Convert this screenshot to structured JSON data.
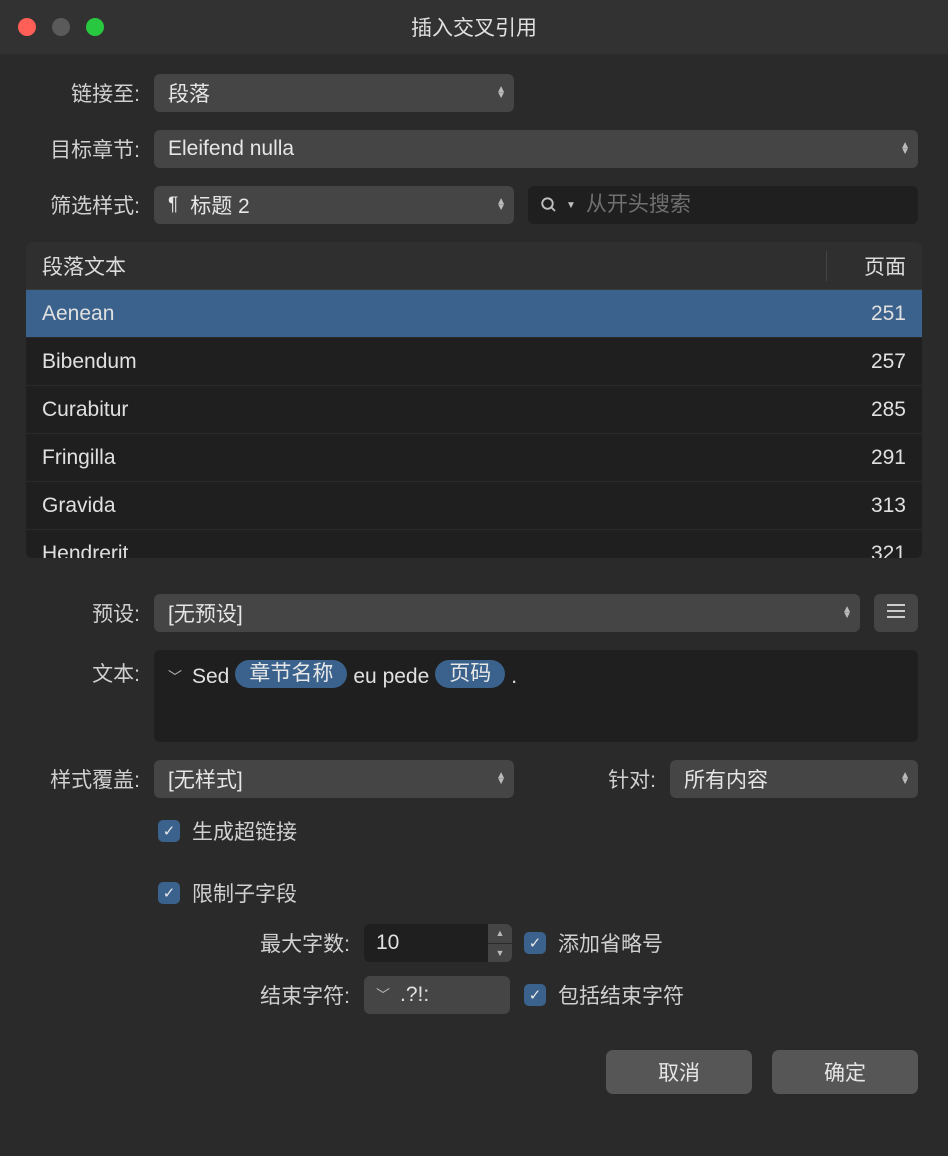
{
  "title": "插入交叉引用",
  "labels": {
    "link_to": "链接至:",
    "target_chapter": "目标章节:",
    "filter_style": "筛选样式:",
    "preset": "预设:",
    "text": "文本:",
    "style_override": "样式覆盖:",
    "for": "针对:",
    "max_chars": "最大字数:",
    "end_chars": "结束字符:"
  },
  "fields": {
    "link_to": "段落",
    "target_chapter": "Eleifend nulla",
    "filter_style": "标题 2",
    "search_placeholder": "从开头搜索",
    "preset": "[无预设]",
    "style_override": "[无样式]",
    "for": "所有内容",
    "max_chars": "10",
    "end_chars": ".?!:"
  },
  "text_template": {
    "prefix": "Sed",
    "token1": "章节名称",
    "mid": "eu pede",
    "token2": "页码",
    "suffix": "."
  },
  "checkboxes": {
    "generate_hyperlink": "生成超链接",
    "limit_substring": "限制子字段",
    "add_ellipsis": "添加省略号",
    "include_end_chars": "包括结束字符"
  },
  "table": {
    "header_text": "段落文本",
    "header_page": "页面",
    "rows": [
      {
        "text": "Aenean",
        "page": "251",
        "selected": true
      },
      {
        "text": "Bibendum",
        "page": "257",
        "selected": false
      },
      {
        "text": "Curabitur",
        "page": "285",
        "selected": false
      },
      {
        "text": "Fringilla",
        "page": "291",
        "selected": false
      },
      {
        "text": "Gravida",
        "page": "313",
        "selected": false
      },
      {
        "text": "Hendrerit",
        "page": "321",
        "selected": false
      }
    ]
  },
  "buttons": {
    "cancel": "取消",
    "ok": "确定"
  }
}
